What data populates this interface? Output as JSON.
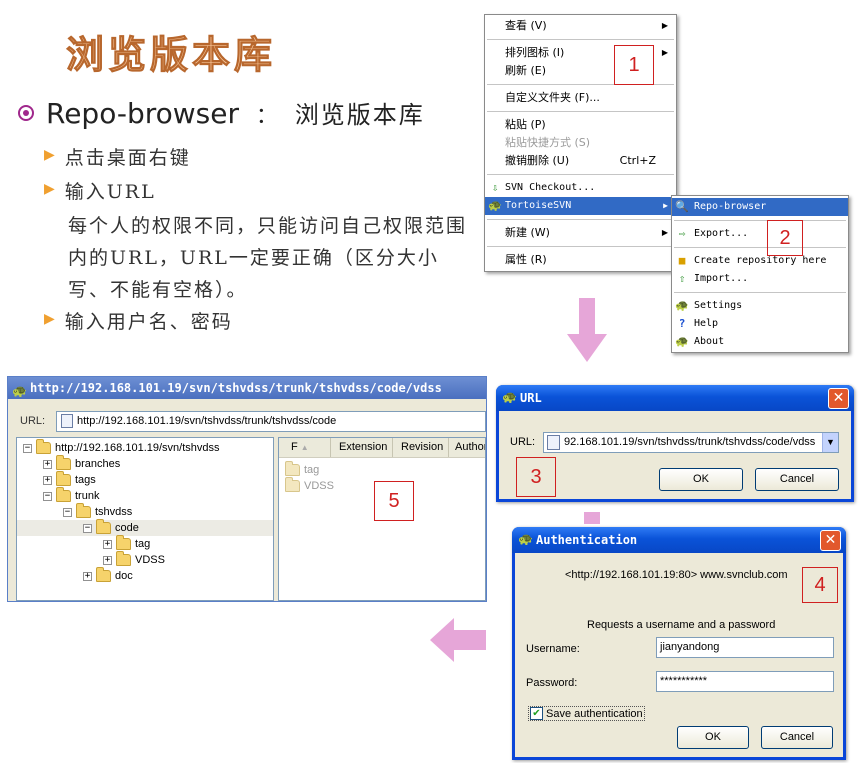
{
  "slide": {
    "title": "浏览版本库",
    "main_bullet_en": "Repo-browser",
    "main_bullet_sep": "：",
    "main_bullet_cn": "浏览版本库",
    "sub1": "点击桌面右键",
    "sub2": "输入URL",
    "paragraph": "每个人的权限不同，只能访问自己权限范围内的URL，URL一定要正确（区分大小写、不能有空格）。",
    "sub3": "输入用户名、密码"
  },
  "context_menu": {
    "view": "查看 (V)",
    "arrange": "排列图标 (I)",
    "refresh": "刷新 (E)",
    "customize": "自定义文件夹 (F)...",
    "paste": "粘贴 (P)",
    "paste_shortcut": "粘贴快捷方式 (S)",
    "undo_delete": "撤销删除 (U)",
    "undo_shortcut": "Ctrl+Z",
    "svn_checkout": "SVN Checkout...",
    "tortoisesvn": "TortoiseSVN",
    "new": "新建 (W)",
    "properties": "属性 (R)"
  },
  "svn_submenu": {
    "repo_browser": "Repo-browser",
    "export": "Export...",
    "create_repo": "Create repository here",
    "import": "Import...",
    "settings": "Settings",
    "help": "Help",
    "about": "About"
  },
  "labels": {
    "step1": "1",
    "step2": "2",
    "step3": "3",
    "step4": "4",
    "step5": "5"
  },
  "url_dialog": {
    "title": "URL",
    "url_label": "URL:",
    "url_value": "92.168.101.19/svn/tshvdss/trunk/tshvdss/code/vdss",
    "ok": "OK",
    "cancel": "Cancel"
  },
  "auth_dialog": {
    "title": "Authentication",
    "realm": "<http://192.168.101.19:80> www.svnclub.com",
    "request": "Requests a username and a password",
    "username_label": "Username:",
    "username_value": "jianyandong",
    "password_label": "Password:",
    "password_value": "***********",
    "save_auth": "Save authentication",
    "ok": "OK",
    "cancel": "Cancel"
  },
  "repo_browser": {
    "title": "http://192.168.101.19/svn/tshvdss/trunk/tshvdss/code/vdss",
    "url_label": "URL:",
    "url_value": "http://192.168.101.19/svn/tshvdss/trunk/tshvdss/code",
    "tree": [
      {
        "label": "http://192.168.101.19/svn/tshvdss",
        "expander": "−"
      },
      {
        "label": "branches",
        "expander": "+"
      },
      {
        "label": "tags",
        "expander": "+"
      },
      {
        "label": "trunk",
        "expander": "−"
      },
      {
        "label": "tshvdss",
        "expander": "−"
      },
      {
        "label": "code",
        "expander": "−"
      },
      {
        "label": "tag",
        "expander": "+"
      },
      {
        "label": "VDSS",
        "expander": "+"
      },
      {
        "label": "doc",
        "expander": "+"
      }
    ],
    "columns": [
      "F",
      "Extension",
      "Revision",
      "Author"
    ],
    "files": [
      "tag",
      "VDSS"
    ]
  },
  "colors": {
    "xp_blue": "#0a53d8",
    "highlight": "#316ac5",
    "arrow_pink": "#e6a6d8",
    "step_red": "#d02020",
    "bullet_purple": "#a0288c"
  }
}
